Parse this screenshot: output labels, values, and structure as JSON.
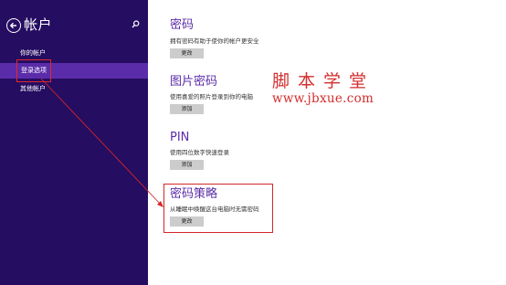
{
  "sidebar": {
    "title": "帐户",
    "items": [
      {
        "label": "你的帐户"
      },
      {
        "label": "登录选项"
      },
      {
        "label": "其他帐户"
      }
    ]
  },
  "sections": [
    {
      "title": "密码",
      "desc": "拥有密码有助于使你的帐户更安全",
      "button": "更改"
    },
    {
      "title": "图片密码",
      "desc": "使用喜爱的照片登录到你的电脑",
      "button": "添加"
    },
    {
      "title": "PIN",
      "desc": "使用四位数字快速登录",
      "button": "添加"
    },
    {
      "title": "密码策略",
      "desc": "从睡眠中唤醒这台电脑时无需密码",
      "button": "更改"
    }
  ],
  "watermark": {
    "name": "脚本学堂",
    "url": "www.jbxue.com"
  },
  "colors": {
    "sidebar_bg": "#250d61",
    "selected_bg": "#5b2ca9",
    "accent": "#5b2ca9",
    "annotation_red": "#d4262a"
  }
}
